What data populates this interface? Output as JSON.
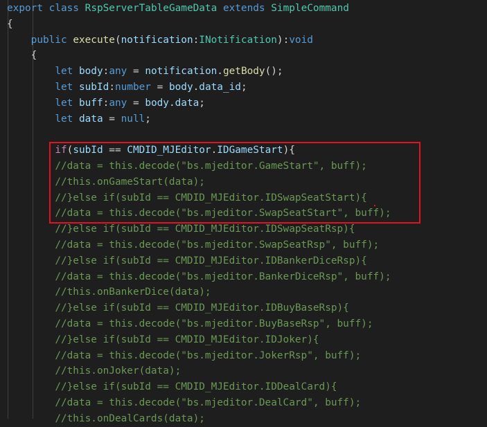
{
  "theme_colors": {
    "background": "#1e1e1e",
    "keyword": "#569cd6",
    "class_name": "#4ec9b0",
    "function_name": "#dcdcaa",
    "variable": "#9cdcfe",
    "comment": "#6a9955",
    "string": "#ce9178",
    "punctuation": "#d4d4d4",
    "control_keyword": "#c586c0",
    "highlight_box": "#e81123"
  },
  "code_lines": [
    [
      {
        "t": "export",
        "c": "keyword"
      },
      {
        "t": " ",
        "c": "punctuation"
      },
      {
        "t": "class",
        "c": "keyword"
      },
      {
        "t": " ",
        "c": "punctuation"
      },
      {
        "t": "RspServerTableGameData",
        "c": "class_name"
      },
      {
        "t": " ",
        "c": "punctuation"
      },
      {
        "t": "extends",
        "c": "keyword"
      },
      {
        "t": " ",
        "c": "punctuation"
      },
      {
        "t": "SimpleCommand",
        "c": "class_name"
      }
    ],
    [
      {
        "t": "{",
        "c": "punctuation"
      }
    ],
    [
      {
        "t": "    ",
        "c": "punctuation"
      },
      {
        "t": "public",
        "c": "keyword"
      },
      {
        "t": " ",
        "c": "punctuation"
      },
      {
        "t": "execute",
        "c": "function_name"
      },
      {
        "t": "(",
        "c": "punctuation"
      },
      {
        "t": "notification",
        "c": "variable"
      },
      {
        "t": ":",
        "c": "punctuation"
      },
      {
        "t": "INotification",
        "c": "class_name"
      },
      {
        "t": "):",
        "c": "punctuation"
      },
      {
        "t": "void",
        "c": "keyword"
      }
    ],
    [
      {
        "t": "    ",
        "c": "punctuation"
      },
      {
        "t": "{",
        "c": "punctuation"
      }
    ],
    [
      {
        "t": "        ",
        "c": "punctuation"
      },
      {
        "t": "let",
        "c": "keyword"
      },
      {
        "t": " ",
        "c": "punctuation"
      },
      {
        "t": "body",
        "c": "variable"
      },
      {
        "t": ":",
        "c": "punctuation"
      },
      {
        "t": "any",
        "c": "keyword"
      },
      {
        "t": " = ",
        "c": "punctuation"
      },
      {
        "t": "notification",
        "c": "variable"
      },
      {
        "t": ".",
        "c": "punctuation"
      },
      {
        "t": "getBody",
        "c": "function_name"
      },
      {
        "t": "();",
        "c": "punctuation"
      }
    ],
    [
      {
        "t": "        ",
        "c": "punctuation"
      },
      {
        "t": "let",
        "c": "keyword"
      },
      {
        "t": " ",
        "c": "punctuation"
      },
      {
        "t": "subId",
        "c": "variable"
      },
      {
        "t": ":",
        "c": "punctuation"
      },
      {
        "t": "number",
        "c": "keyword"
      },
      {
        "t": " = ",
        "c": "punctuation"
      },
      {
        "t": "body",
        "c": "variable"
      },
      {
        "t": ".",
        "c": "punctuation"
      },
      {
        "t": "data_id",
        "c": "variable"
      },
      {
        "t": ";",
        "c": "punctuation"
      }
    ],
    [
      {
        "t": "        ",
        "c": "punctuation"
      },
      {
        "t": "let",
        "c": "keyword"
      },
      {
        "t": " ",
        "c": "punctuation"
      },
      {
        "t": "buff",
        "c": "variable"
      },
      {
        "t": ":",
        "c": "punctuation"
      },
      {
        "t": "any",
        "c": "keyword"
      },
      {
        "t": " = ",
        "c": "punctuation"
      },
      {
        "t": "body",
        "c": "variable"
      },
      {
        "t": ".",
        "c": "punctuation"
      },
      {
        "t": "data",
        "c": "variable"
      },
      {
        "t": ";",
        "c": "punctuation"
      }
    ],
    [
      {
        "t": "        ",
        "c": "punctuation"
      },
      {
        "t": "let",
        "c": "keyword"
      },
      {
        "t": " ",
        "c": "punctuation"
      },
      {
        "t": "data",
        "c": "variable"
      },
      {
        "t": " = ",
        "c": "punctuation"
      },
      {
        "t": "null",
        "c": "keyword"
      },
      {
        "t": ";",
        "c": "punctuation"
      }
    ],
    [],
    [
      {
        "t": "        ",
        "c": "punctuation"
      },
      {
        "t": "if",
        "c": "control_keyword"
      },
      {
        "t": "(",
        "c": "punctuation"
      },
      {
        "t": "subId",
        "c": "variable"
      },
      {
        "t": " == ",
        "c": "punctuation"
      },
      {
        "t": "CMDID_MJEditor",
        "c": "variable"
      },
      {
        "t": ".",
        "c": "punctuation"
      },
      {
        "t": "IDGameStart",
        "c": "variable"
      },
      {
        "t": "){",
        "c": "punctuation"
      }
    ],
    [
      {
        "t": "        ",
        "c": "punctuation"
      },
      {
        "t": "//data = this.decode(\"bs.mjeditor.GameStart\", buff);",
        "c": "comment"
      }
    ],
    [
      {
        "t": "        ",
        "c": "punctuation"
      },
      {
        "t": "//this.onGameStart(data);",
        "c": "comment"
      }
    ],
    [
      {
        "t": "        ",
        "c": "punctuation"
      },
      {
        "t": "//}else if(subId == CMDID_MJEditor.IDSwapSeatStart){",
        "c": "comment"
      }
    ],
    [
      {
        "t": "        ",
        "c": "punctuation"
      },
      {
        "t": "//data = this.decode(\"bs.mjeditor.SwapSeatStart\", buff);",
        "c": "comment"
      }
    ],
    [
      {
        "t": "        ",
        "c": "punctuation"
      },
      {
        "t": "//}else if(subId == CMDID_MJEditor.IDSwapSeatRsp){",
        "c": "comment"
      }
    ],
    [
      {
        "t": "        ",
        "c": "punctuation"
      },
      {
        "t": "//data = this.decode(\"bs.mjeditor.SwapSeatRsp\", buff);",
        "c": "comment"
      }
    ],
    [
      {
        "t": "        ",
        "c": "punctuation"
      },
      {
        "t": "//}else if(subId == CMDID_MJEditor.IDBankerDiceRsp){",
        "c": "comment"
      }
    ],
    [
      {
        "t": "        ",
        "c": "punctuation"
      },
      {
        "t": "//data = this.decode(\"bs.mjeditor.BankerDiceRsp\", buff);",
        "c": "comment"
      }
    ],
    [
      {
        "t": "        ",
        "c": "punctuation"
      },
      {
        "t": "//this.onBankerDice(data);",
        "c": "comment"
      }
    ],
    [
      {
        "t": "        ",
        "c": "punctuation"
      },
      {
        "t": "//}else if(subId == CMDID_MJEditor.IDBuyBaseRsp){",
        "c": "comment"
      }
    ],
    [
      {
        "t": "        ",
        "c": "punctuation"
      },
      {
        "t": "//data = this.decode(\"bs.mjeditor.BuyBaseRsp\", buff);",
        "c": "comment"
      }
    ],
    [
      {
        "t": "        ",
        "c": "punctuation"
      },
      {
        "t": "//}else if(subId == CMDID_MJEditor.IDJoker){",
        "c": "comment"
      }
    ],
    [
      {
        "t": "        ",
        "c": "punctuation"
      },
      {
        "t": "//data = this.decode(\"bs.mjeditor.JokerRsp\", buff);",
        "c": "comment"
      }
    ],
    [
      {
        "t": "        ",
        "c": "punctuation"
      },
      {
        "t": "//this.onJoker(data);",
        "c": "comment"
      }
    ],
    [
      {
        "t": "        ",
        "c": "punctuation"
      },
      {
        "t": "//}else if(subId == CMDID_MJEditor.IDDealCard){",
        "c": "comment"
      }
    ],
    [
      {
        "t": "        ",
        "c": "punctuation"
      },
      {
        "t": "//data = this.decode(\"bs.mjeditor.DealCard\", buff);",
        "c": "comment"
      }
    ],
    [
      {
        "t": "        ",
        "c": "punctuation"
      },
      {
        "t": "//this.onDealCards(data);",
        "c": "comment"
      }
    ]
  ]
}
